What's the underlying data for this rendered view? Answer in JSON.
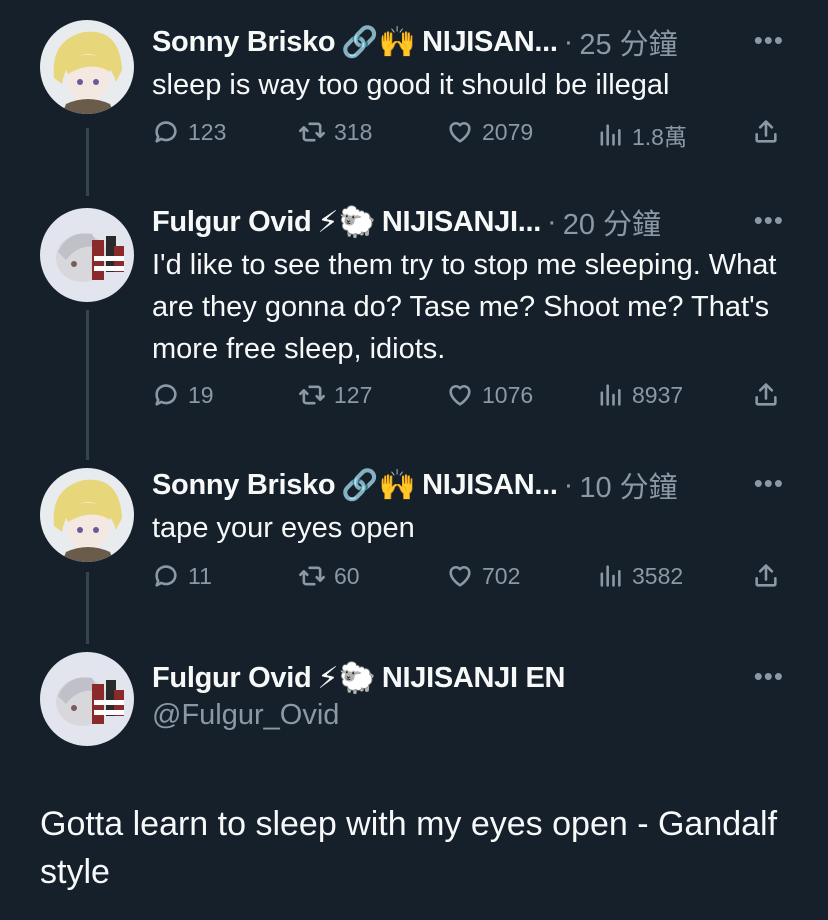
{
  "tweets": [
    {
      "author": "Sonny Brisko",
      "badges": "🔗🙌",
      "affiliation": "NIJISAN...",
      "time": "25 分鐘",
      "text": "sleep is way too good it should be illegal",
      "replies": "123",
      "retweets": "318",
      "likes": "2079",
      "views": "1.8萬"
    },
    {
      "author": "Fulgur Ovid",
      "badges": "⚡🐑",
      "affiliation": "NIJISANJI...",
      "time": "20 分鐘",
      "text": "I'd like to see them try to stop me sleeping. What are they gonna do? Tase me? Shoot me? That's more free sleep, idiots.",
      "replies": "19",
      "retweets": "127",
      "likes": "1076",
      "views": "8937"
    },
    {
      "author": "Sonny Brisko",
      "badges": "🔗🙌",
      "affiliation": "NIJISAN...",
      "time": "10 分鐘",
      "text": "tape your eyes open",
      "replies": "11",
      "retweets": "60",
      "likes": "702",
      "views": "3582"
    }
  ],
  "main_tweet": {
    "author": "Fulgur Ovid",
    "badges": "⚡🐑",
    "affiliation": "NIJISANJI EN",
    "handle": "@Fulgur_Ovid",
    "text": "Gotta learn to sleep with my eyes open - Gandalf style"
  },
  "separator": "·",
  "more_glyph": "•••",
  "colors": {
    "background": "#15202b",
    "text": "#f7f9f9",
    "muted": "#8b98a5",
    "thread_line": "#38444d"
  }
}
